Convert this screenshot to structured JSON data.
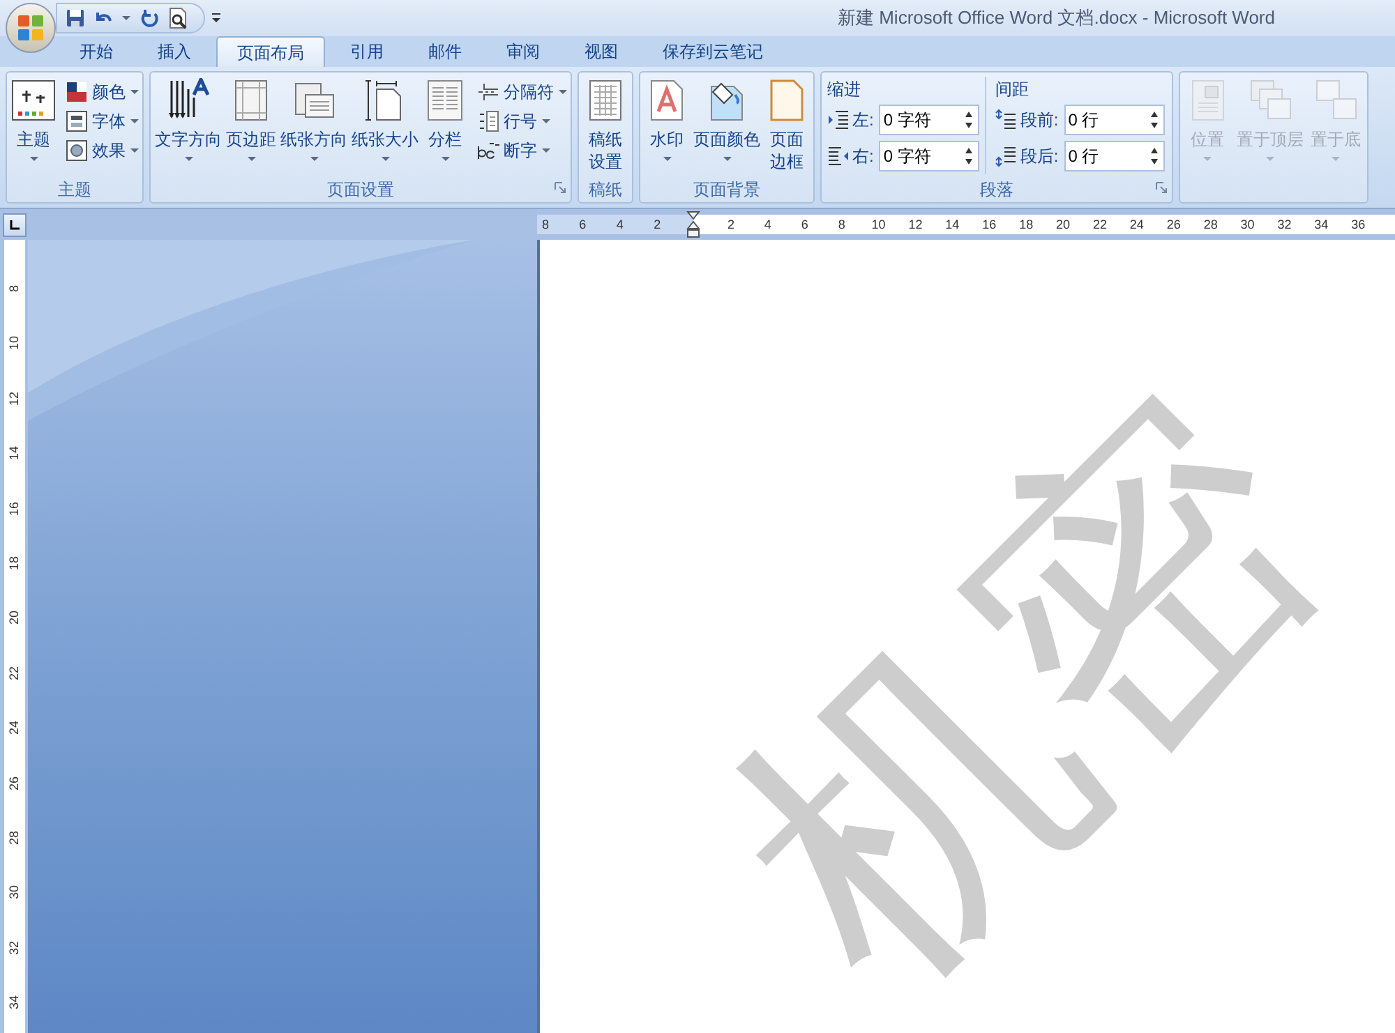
{
  "window": {
    "title": "新建 Microsoft Office Word 文档.docx - Microsoft Word"
  },
  "tabs": [
    {
      "label": "开始",
      "selected": false
    },
    {
      "label": "插入",
      "selected": false
    },
    {
      "label": "页面布局",
      "selected": true
    },
    {
      "label": "引用",
      "selected": false
    },
    {
      "label": "邮件",
      "selected": false
    },
    {
      "label": "审阅",
      "selected": false
    },
    {
      "label": "视图",
      "selected": false
    },
    {
      "label": "保存到云笔记",
      "selected": false
    }
  ],
  "ribbon": [
    {
      "label": "主题",
      "launcher": false,
      "items": [
        {
          "kind": "large",
          "label": "主题",
          "dropdown": true
        },
        {
          "kind": "stack",
          "items": [
            {
              "label": "颜色",
              "dropdown": true
            },
            {
              "label": "字体",
              "dropdown": true
            },
            {
              "label": "效果",
              "dropdown": true
            }
          ]
        }
      ]
    },
    {
      "label": "页面设置",
      "launcher": true,
      "items": [
        {
          "kind": "large",
          "label": "文字方向",
          "dropdown": true
        },
        {
          "kind": "large",
          "label": "页边距",
          "dropdown": true
        },
        {
          "kind": "large",
          "label": "纸张方向",
          "dropdown": true
        },
        {
          "kind": "large",
          "label": "纸张大小",
          "dropdown": true
        },
        {
          "kind": "large",
          "label": "分栏",
          "dropdown": true
        },
        {
          "kind": "stack",
          "items": [
            {
              "label": "分隔符",
              "dropdown": true
            },
            {
              "label": "行号",
              "dropdown": true
            },
            {
              "label": "断字",
              "dropdown": true
            }
          ]
        }
      ]
    },
    {
      "label": "稿纸",
      "launcher": false,
      "items": [
        {
          "kind": "large",
          "label": "稿纸设置",
          "dropdown": false
        }
      ]
    },
    {
      "label": "页面背景",
      "launcher": false,
      "items": [
        {
          "kind": "large",
          "label": "水印",
          "dropdown": true
        },
        {
          "kind": "large",
          "label": "页面颜色",
          "dropdown": true
        },
        {
          "kind": "large",
          "label": "页面边框",
          "dropdown": false
        }
      ]
    },
    {
      "label": "段落",
      "launcher": true,
      "items": [
        {
          "kind": "spinners",
          "heading": "缩进",
          "fields": [
            {
              "label": "左:",
              "value": "0 字符"
            },
            {
              "label": "右:",
              "value": "0 字符"
            }
          ]
        },
        {
          "kind": "spinners",
          "heading": "间距",
          "fields": [
            {
              "label": "段前:",
              "value": "0 行"
            },
            {
              "label": "段后:",
              "value": "0 行"
            }
          ]
        }
      ]
    },
    {
      "launcher": false,
      "items": [
        {
          "kind": "large",
          "label": "位置",
          "dropdown": true,
          "disabled": true
        },
        {
          "kind": "large",
          "label": "置于顶层",
          "dropdown": true,
          "disabled": true
        },
        {
          "kind": "large",
          "label": "置于底",
          "dropdown": true,
          "disabled": true
        }
      ]
    }
  ],
  "ruler": {
    "horizontal": [
      "8",
      "6",
      "4",
      "2",
      "2",
      "4",
      "6",
      "8",
      "10",
      "12",
      "14",
      "16",
      "18",
      "20",
      "22",
      "24",
      "26",
      "28",
      "30",
      "32",
      "34",
      "36"
    ],
    "vertical": [
      "8",
      "10",
      "12",
      "14",
      "16",
      "18",
      "20",
      "22",
      "24",
      "26",
      "28",
      "30",
      "32",
      "34"
    ]
  },
  "document": {
    "watermark": "机密"
  }
}
